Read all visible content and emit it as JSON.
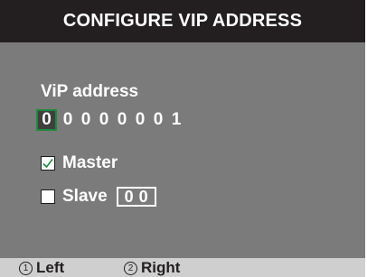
{
  "title": "CONFIGURE VIP ADDRESS",
  "vip": {
    "label": "ViP address",
    "digits": [
      "0",
      "0",
      "0",
      "0",
      "0",
      "0",
      "0",
      "1"
    ]
  },
  "master": {
    "label": "Master",
    "checked": true
  },
  "slave": {
    "label": "Slave",
    "checked": false,
    "digits": [
      "0",
      "0"
    ]
  },
  "footer": {
    "left": {
      "key": "1",
      "label": "Left"
    },
    "right": {
      "key": "2",
      "label": "Right"
    }
  },
  "colors": {
    "screen_bg": "#7b7b7b",
    "title_bg": "#231f20",
    "footer_bg": "#cfcfcf",
    "selection_border": "#1e8a3c",
    "checkmark": "#1e8a3c"
  }
}
